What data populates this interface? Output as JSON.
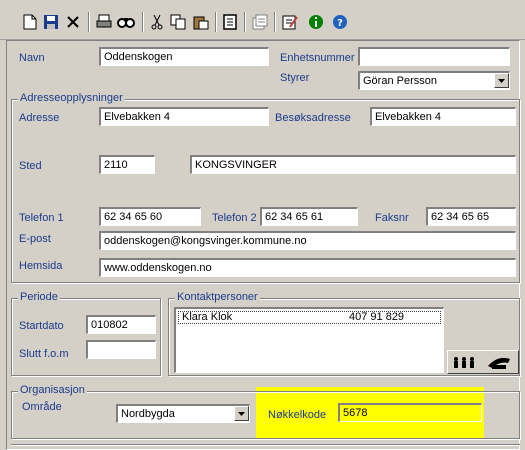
{
  "toolbar": {
    "buttons": [
      "new-icon",
      "save-icon",
      "delete-icon",
      "print-icon",
      "find-icon",
      "cut-icon",
      "copy-icon",
      "paste-icon",
      "report-icon",
      "properties-icon",
      "edit-icon",
      "info-icon",
      "help-icon"
    ]
  },
  "form": {
    "navn_label": "Navn",
    "navn_value": "Oddenskogen",
    "enhetsnummer_label": "Enhetsnummer",
    "enhetsnummer_value": "",
    "styrer_label": "Styrer",
    "styrer_value": "Göran Persson"
  },
  "address": {
    "group_title": "Adresseopplysninger",
    "adresse_label": "Adresse",
    "adresse_value": "Elvebakken 4",
    "besok_label": "Besøksadresse",
    "besok_value": "Elvebakken 4",
    "sted_label": "Sted",
    "postnr_value": "2110",
    "poststed_value": "KONGSVINGER",
    "telefon1_label": "Telefon 1",
    "telefon1_value": "62 34 65 60",
    "telefon2_label": "Telefon 2",
    "telefon2_value": "62 34 65 61",
    "faksnr_label": "Faksnr",
    "faksnr_value": "62 34 65 65",
    "epost_label": "E-post",
    "epost_value": "oddenskogen@kongsvinger.kommune.no",
    "hjemmeside_label": "Hemsida",
    "hjemmeside_value": "www.oddenskogen.no"
  },
  "periode": {
    "group_title": "Periode",
    "startdato_label": "Startdato",
    "startdato_value": "010802",
    "slutt_label": "Slutt f.o.m",
    "slutt_value": ""
  },
  "kontakt": {
    "group_title": "Kontaktpersoner",
    "rows": [
      {
        "name": "Klara Klok",
        "phone": "407 91 829"
      }
    ]
  },
  "organisasjon": {
    "group_title": "Organisasjon",
    "omrade_label": "Område",
    "omrade_value": "Nordbygda",
    "nokkelkode_label": "Nøkkelkode",
    "nokkelkode_value": "5678"
  },
  "colors": {
    "label": "#1a3c8c",
    "highlight": "#ffff00",
    "window": "#d4d0c8"
  }
}
